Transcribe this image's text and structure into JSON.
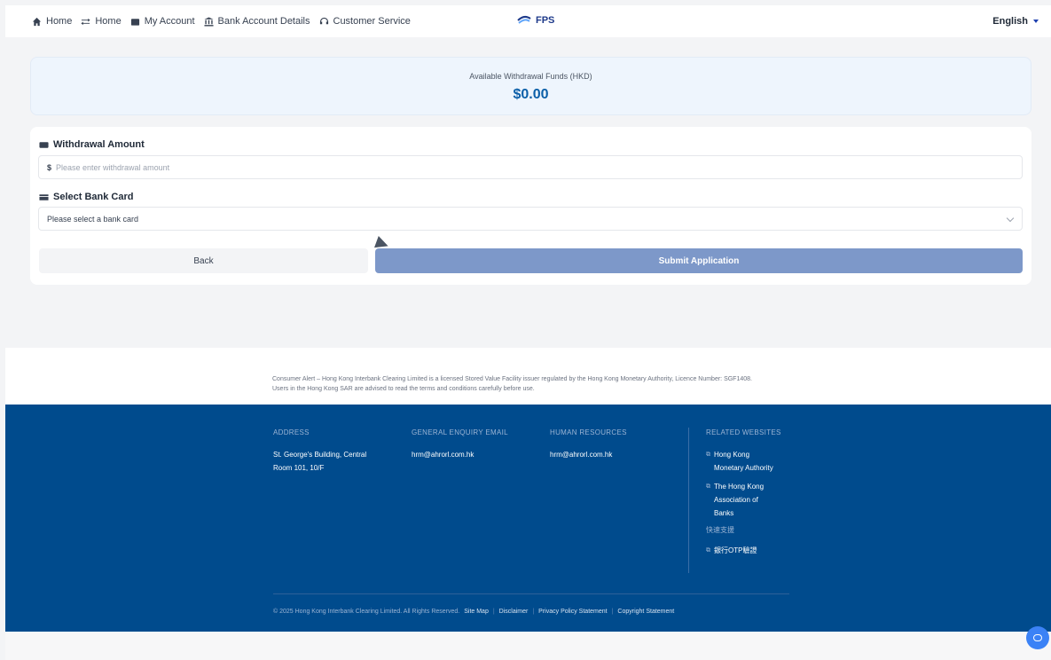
{
  "nav": {
    "items": [
      {
        "label": "Home",
        "icon": "home-icon"
      },
      {
        "label": "Home",
        "icon": "transfer-icon"
      },
      {
        "label": "My Account",
        "icon": "wallet-icon"
      },
      {
        "label": "Bank Account Details",
        "icon": "bank-icon"
      },
      {
        "label": "Customer Service",
        "icon": "headset-icon"
      }
    ],
    "brand": "FPS",
    "language": "English"
  },
  "funds": {
    "label": "Available Withdrawal Funds (HKD)",
    "value": "$0.00"
  },
  "form": {
    "amount_title": "Withdrawal Amount",
    "amount_currency": "$",
    "amount_placeholder": "Please enter withdrawal amount",
    "card_title": "Select Bank Card",
    "card_value": "Please select a bank card",
    "back_label": "Back",
    "submit_label": "Submit Application"
  },
  "alert": {
    "text": "Consumer Alert – Hong Kong Interbank Clearing Limited is a licensed Stored Value Facility issuer regulated by the Hong Kong Monetary Authority, Licence Number: SGF1408. Users in the Hong Kong SAR are advised to read the terms and conditions carefully before use."
  },
  "footer": {
    "address_head": "ADDRESS",
    "address_line1": "St. George's Building, Central",
    "address_line2": "Room 101, 10/F",
    "enquiry_head": "GENERAL ENQUIRY EMAIL",
    "enquiry_email": "hrm@ahrorl.com.hk",
    "hr_head": "HUMAN RESOURCES",
    "hr_email": "hrm@ahrorl.com.hk",
    "related_head": "RELATED WEBSITES",
    "related_1_line1": "Hong Kong",
    "related_1_line2": "Monetary Authority",
    "related_2_line1": "The Hong Kong",
    "related_2_line2": "Association of",
    "related_2_line3": "Banks",
    "support_head": "快速支援",
    "related_3": "銀行OTP驗證",
    "copyright": "© 2025 Hong Kong Interbank Clearing Limited. All Rights Reserved.",
    "sitemap": "Site Map",
    "disclaimer": "Disclaimer",
    "privacy": "Privacy Policy Statement",
    "copyright_statement": "Copyright Statement"
  },
  "colors": {
    "footer_bg": "#004b8d",
    "accent": "#0b5fa8",
    "submit_bg": "#7d98c9"
  }
}
